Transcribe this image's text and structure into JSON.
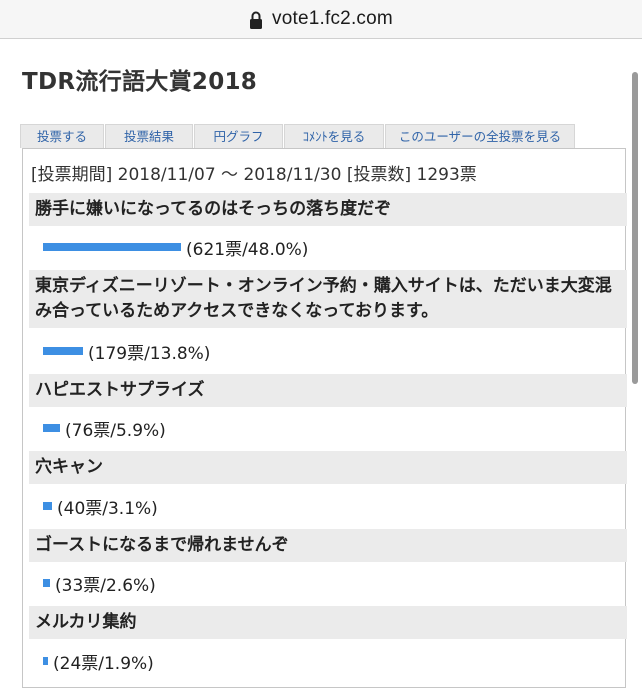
{
  "browser": {
    "url": "vote1.fc2.com"
  },
  "page": {
    "title": "TDR流行語大賞2018"
  },
  "tabs": [
    {
      "label": "投票する"
    },
    {
      "label": "投票結果"
    },
    {
      "label": "円グラフ"
    },
    {
      "label": "ｺﾒﾝﾄを見る"
    },
    {
      "label": "このユーザーの全投票を見る"
    }
  ],
  "summary": {
    "period_label": "[投票期間]",
    "period_value": "2018/11/07 〜 2018/11/30",
    "count_label": "[投票数]",
    "count_value": "1293票"
  },
  "results": [
    {
      "title": "勝手に嫌いになってるのはそっちの落ち度だぞ",
      "share": 48.0,
      "votes_text": "(621票/48.0%)"
    },
    {
      "title": "東京ディズニーリゾート・オンライン予約・購入サイトは、ただいま大変混み合っているためアクセスできなくなっております。",
      "share": 13.8,
      "votes_text": "(179票/13.8%)"
    },
    {
      "title": "ハピエストサプライズ",
      "share": 5.9,
      "votes_text": "(76票/5.9%)"
    },
    {
      "title": "穴キャン",
      "share": 3.1,
      "votes_text": "(40票/3.1%)"
    },
    {
      "title": "ゴーストになるまで帰れませんぞ",
      "share": 2.6,
      "votes_text": "(33票/2.6%)"
    },
    {
      "title": "メルカリ集約",
      "share": 1.9,
      "votes_text": "(24票/1.9%)"
    }
  ],
  "colors": {
    "bar": "#3d8fe3",
    "item_header_bg": "#ebebeb",
    "tab_text": "#2f63a8"
  }
}
